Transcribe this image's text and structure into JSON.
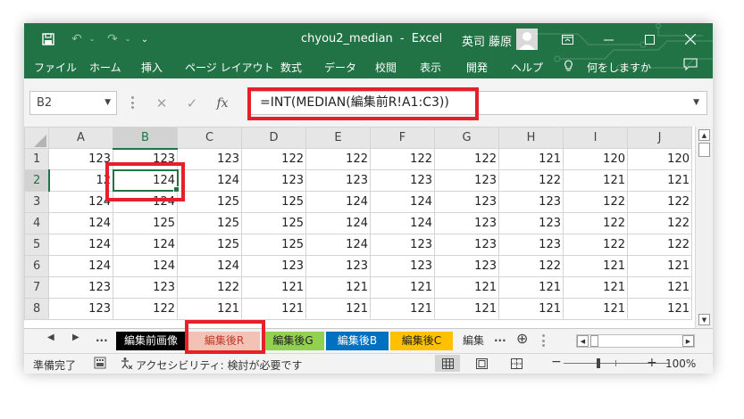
{
  "titlebar": {
    "filename": "chyou2_median",
    "separator": "-",
    "app": "Excel",
    "user": "英司 藤原",
    "qat_customize": "⌄"
  },
  "ribbon": {
    "tabs": [
      "ファイル",
      "ホーム",
      "挿入",
      "ページ レイアウト",
      "数式",
      "データ",
      "校閲",
      "表示",
      "開発",
      "ヘルプ"
    ],
    "tell_me": "何をしますか"
  },
  "formula_bar": {
    "name_box": "B2",
    "fx_label": "fx",
    "formula": "=INT(MEDIAN(編集前R!A1:C3))"
  },
  "sheet": {
    "columns": [
      "A",
      "B",
      "C",
      "D",
      "E",
      "F",
      "G",
      "H",
      "I",
      "J"
    ],
    "rows": [
      {
        "label": "1",
        "cells": [
          "123",
          "123",
          "123",
          "122",
          "122",
          "122",
          "122",
          "121",
          "120",
          "120"
        ]
      },
      {
        "label": "2",
        "cells": [
          "12",
          "124",
          "124",
          "123",
          "123",
          "123",
          "123",
          "122",
          "121",
          "121"
        ]
      },
      {
        "label": "3",
        "cells": [
          "124",
          "124",
          "125",
          "125",
          "124",
          "124",
          "123",
          "123",
          "122",
          "122"
        ]
      },
      {
        "label": "4",
        "cells": [
          "124",
          "125",
          "125",
          "125",
          "124",
          "124",
          "123",
          "123",
          "122",
          "122"
        ]
      },
      {
        "label": "5",
        "cells": [
          "124",
          "124",
          "125",
          "125",
          "124",
          "123",
          "123",
          "123",
          "122",
          "122"
        ]
      },
      {
        "label": "6",
        "cells": [
          "124",
          "124",
          "124",
          "123",
          "123",
          "123",
          "123",
          "122",
          "121",
          "121"
        ]
      },
      {
        "label": "7",
        "cells": [
          "123",
          "123",
          "122",
          "121",
          "121",
          "121",
          "121",
          "121",
          "121",
          "121"
        ]
      },
      {
        "label": "8",
        "cells": [
          "123",
          "122",
          "121",
          "121",
          "121",
          "121",
          "121",
          "121",
          "121",
          "121"
        ]
      }
    ],
    "active_cell": "B2"
  },
  "sheet_tabs": {
    "more_left": "...",
    "tabs": [
      {
        "label": "編集前画像",
        "bg": "#000000",
        "fg": "#ffffff"
      },
      {
        "label": "編集後R",
        "bg": "#f2c3b5",
        "fg": "#c0392b"
      },
      {
        "label": "編集後G",
        "bg": "#92d050",
        "fg": "#1f1f1f"
      },
      {
        "label": "編集後B",
        "bg": "#0070c0",
        "fg": "#ffffff"
      },
      {
        "label": "編集後C",
        "bg": "#ffc000",
        "fg": "#1f1f1f"
      },
      {
        "label": "編集",
        "bg": "#f3f3f3",
        "fg": "#333333"
      }
    ],
    "more_right": "...",
    "add": "⊕"
  },
  "statusbar": {
    "ready": "準備完了",
    "accessibility": "アクセシビリティ: 検討が必要です",
    "zoom_minus": "−",
    "zoom_plus": "+",
    "zoom": "100%"
  },
  "colors": {
    "brand": "#217346",
    "highlight": "#e5202a"
  }
}
